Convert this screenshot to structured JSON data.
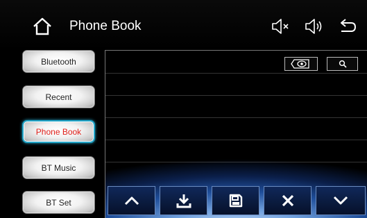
{
  "header": {
    "title": "Phone Book",
    "icons": [
      "home-icon",
      "mute-icon",
      "volume-icon",
      "back-icon"
    ]
  },
  "sidebar": {
    "items": [
      {
        "label": "Bluetooth",
        "active": false
      },
      {
        "label": "Recent",
        "active": false
      },
      {
        "label": "Phone Book",
        "active": true
      },
      {
        "label": "BT Music",
        "active": false
      },
      {
        "label": "BT Set",
        "active": false
      }
    ]
  },
  "content_tools": {
    "icons": [
      "visibility-toggle-icon",
      "search-icon"
    ]
  },
  "toolbar": {
    "icons": [
      "chevron-up-icon",
      "download-icon",
      "save-icon",
      "close-icon",
      "chevron-down-icon"
    ]
  },
  "colors": {
    "active_text": "#e0201b",
    "active_border": "#22a5c8",
    "toolbar_bg": "#0a1a3c"
  }
}
